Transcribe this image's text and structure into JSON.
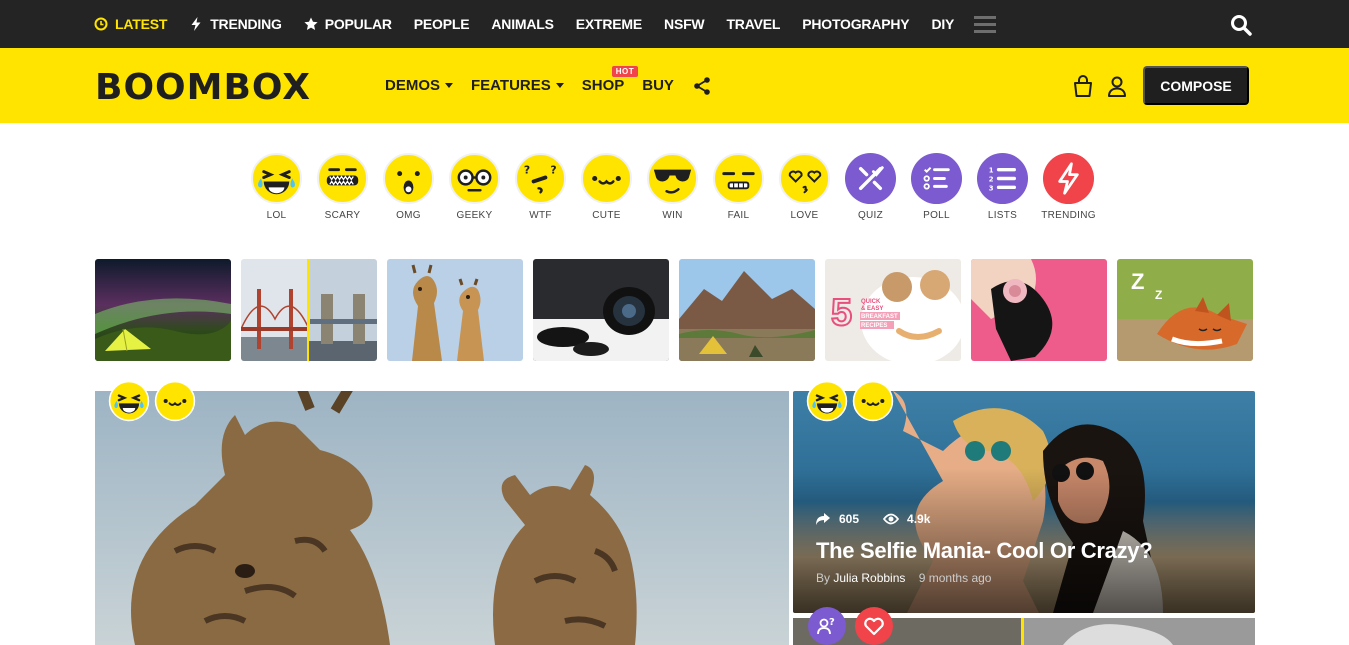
{
  "topnav": [
    {
      "label": "LATEST",
      "icon": "clock-icon",
      "active": true
    },
    {
      "label": "TRENDING",
      "icon": "bolt-icon"
    },
    {
      "label": "POPULAR",
      "icon": "star-icon"
    },
    {
      "label": "PEOPLE"
    },
    {
      "label": "ANIMALS"
    },
    {
      "label": "EXTREME"
    },
    {
      "label": "NSFW"
    },
    {
      "label": "TRAVEL"
    },
    {
      "label": "PHOTOGRAPHY"
    },
    {
      "label": "DIY"
    }
  ],
  "brand": {
    "logo": "BOOMBOX",
    "accent": "#ffe400",
    "dark": "#242424"
  },
  "mainnav": {
    "demos": "DEMOS",
    "features": "FEATURES",
    "shop": "SHOP",
    "hot": "HOT",
    "buy": "BUY"
  },
  "compose_label": "COMPOSE",
  "reactions": [
    {
      "label": "LOL",
      "icon": "lol-icon",
      "color": "#ffe400"
    },
    {
      "label": "SCARY",
      "icon": "scary-icon",
      "color": "#ffe400"
    },
    {
      "label": "OMG",
      "icon": "omg-icon",
      "color": "#ffe400"
    },
    {
      "label": "GEEKY",
      "icon": "geeky-icon",
      "color": "#ffe400"
    },
    {
      "label": "WTF",
      "icon": "wtf-icon",
      "color": "#ffe400"
    },
    {
      "label": "CUTE",
      "icon": "cute-icon",
      "color": "#ffe400"
    },
    {
      "label": "WIN",
      "icon": "win-icon",
      "color": "#ffe400"
    },
    {
      "label": "FAIL",
      "icon": "fail-icon",
      "color": "#ffe400"
    },
    {
      "label": "LOVE",
      "icon": "love-icon",
      "color": "#ffe400"
    },
    {
      "label": "QUIZ",
      "icon": "quiz-icon",
      "color": "#7b5bcf"
    },
    {
      "label": "POLL",
      "icon": "poll-icon",
      "color": "#7b5bcf"
    },
    {
      "label": "LISTS",
      "icon": "lists-icon",
      "color": "#7b5bcf"
    },
    {
      "label": "TRENDING",
      "icon": "trending-bolt-icon",
      "color": "#f0434a"
    }
  ],
  "thumbs": [
    {
      "name": "thumb-aurora-tent"
    },
    {
      "name": "thumb-bridges"
    },
    {
      "name": "thumb-giraffes"
    },
    {
      "name": "thumb-camera-lens"
    },
    {
      "name": "thumb-mountain-camp"
    },
    {
      "name": "thumb-breakfast",
      "text": [
        "5",
        "QUICK",
        "& EASY",
        "BREAKFAST",
        "RECIPES"
      ]
    },
    {
      "name": "thumb-headphones-girl"
    },
    {
      "name": "thumb-sleeping-fox",
      "text": [
        "Z",
        "Z"
      ]
    }
  ],
  "featured": {
    "shares": "605",
    "views": "4.9k",
    "title": "The Selfie Mania- Cool Or Crazy?",
    "by": "By",
    "author": "Julia Robbins",
    "time": "9 months ago"
  }
}
